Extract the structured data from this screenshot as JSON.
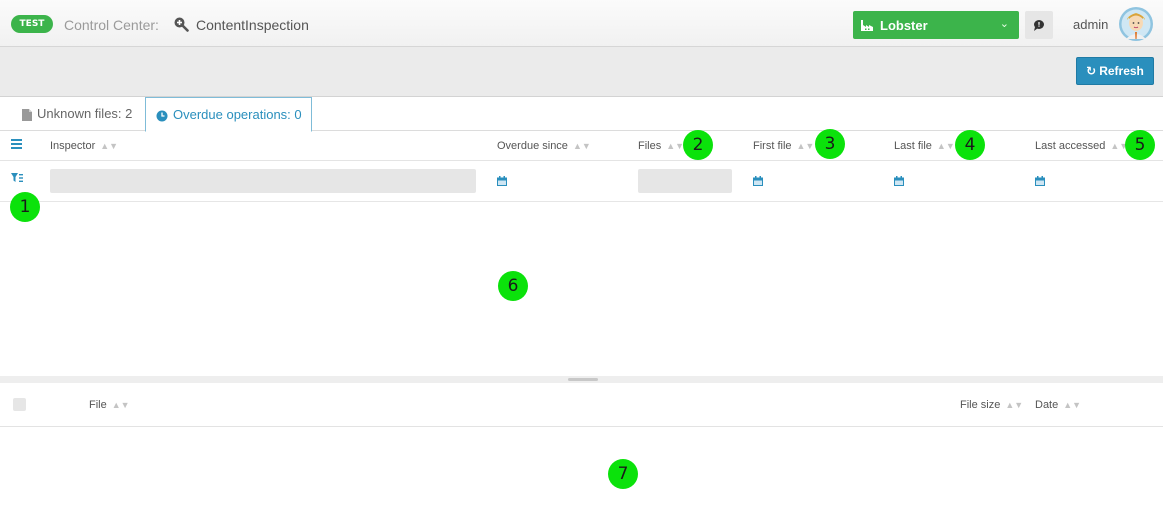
{
  "header": {
    "env_badge": "TEST",
    "app_title": "Control Center:",
    "module_icon": "magnifier-plus-icon",
    "module_name": "ContentInspection",
    "tenant": {
      "label": "Lobster",
      "icon": "factory-icon",
      "color": "#3cb44b"
    },
    "chat_icon": "chat-bubble-icon",
    "user": "admin",
    "avatar_icon": "user-avatar-icon"
  },
  "toolbar": {
    "refresh_label": "Refresh",
    "refresh_icon": "refresh-icon",
    "accent": "#2a8fbd"
  },
  "tabs": [
    {
      "label": "Unknown files: 2",
      "icon": "file-icon",
      "active": false
    },
    {
      "label": "Overdue operations: 0",
      "icon": "clock-icon",
      "active": true
    }
  ],
  "inspector_grid": {
    "columns": [
      "Inspector",
      "Overdue since",
      "Files",
      "First file",
      "Last file",
      "Last accessed"
    ],
    "rows": []
  },
  "files_grid": {
    "columns": [
      "File",
      "File size",
      "Date"
    ],
    "rows": []
  },
  "markers": [
    "1",
    "2",
    "3",
    "4",
    "5",
    "6",
    "7"
  ]
}
